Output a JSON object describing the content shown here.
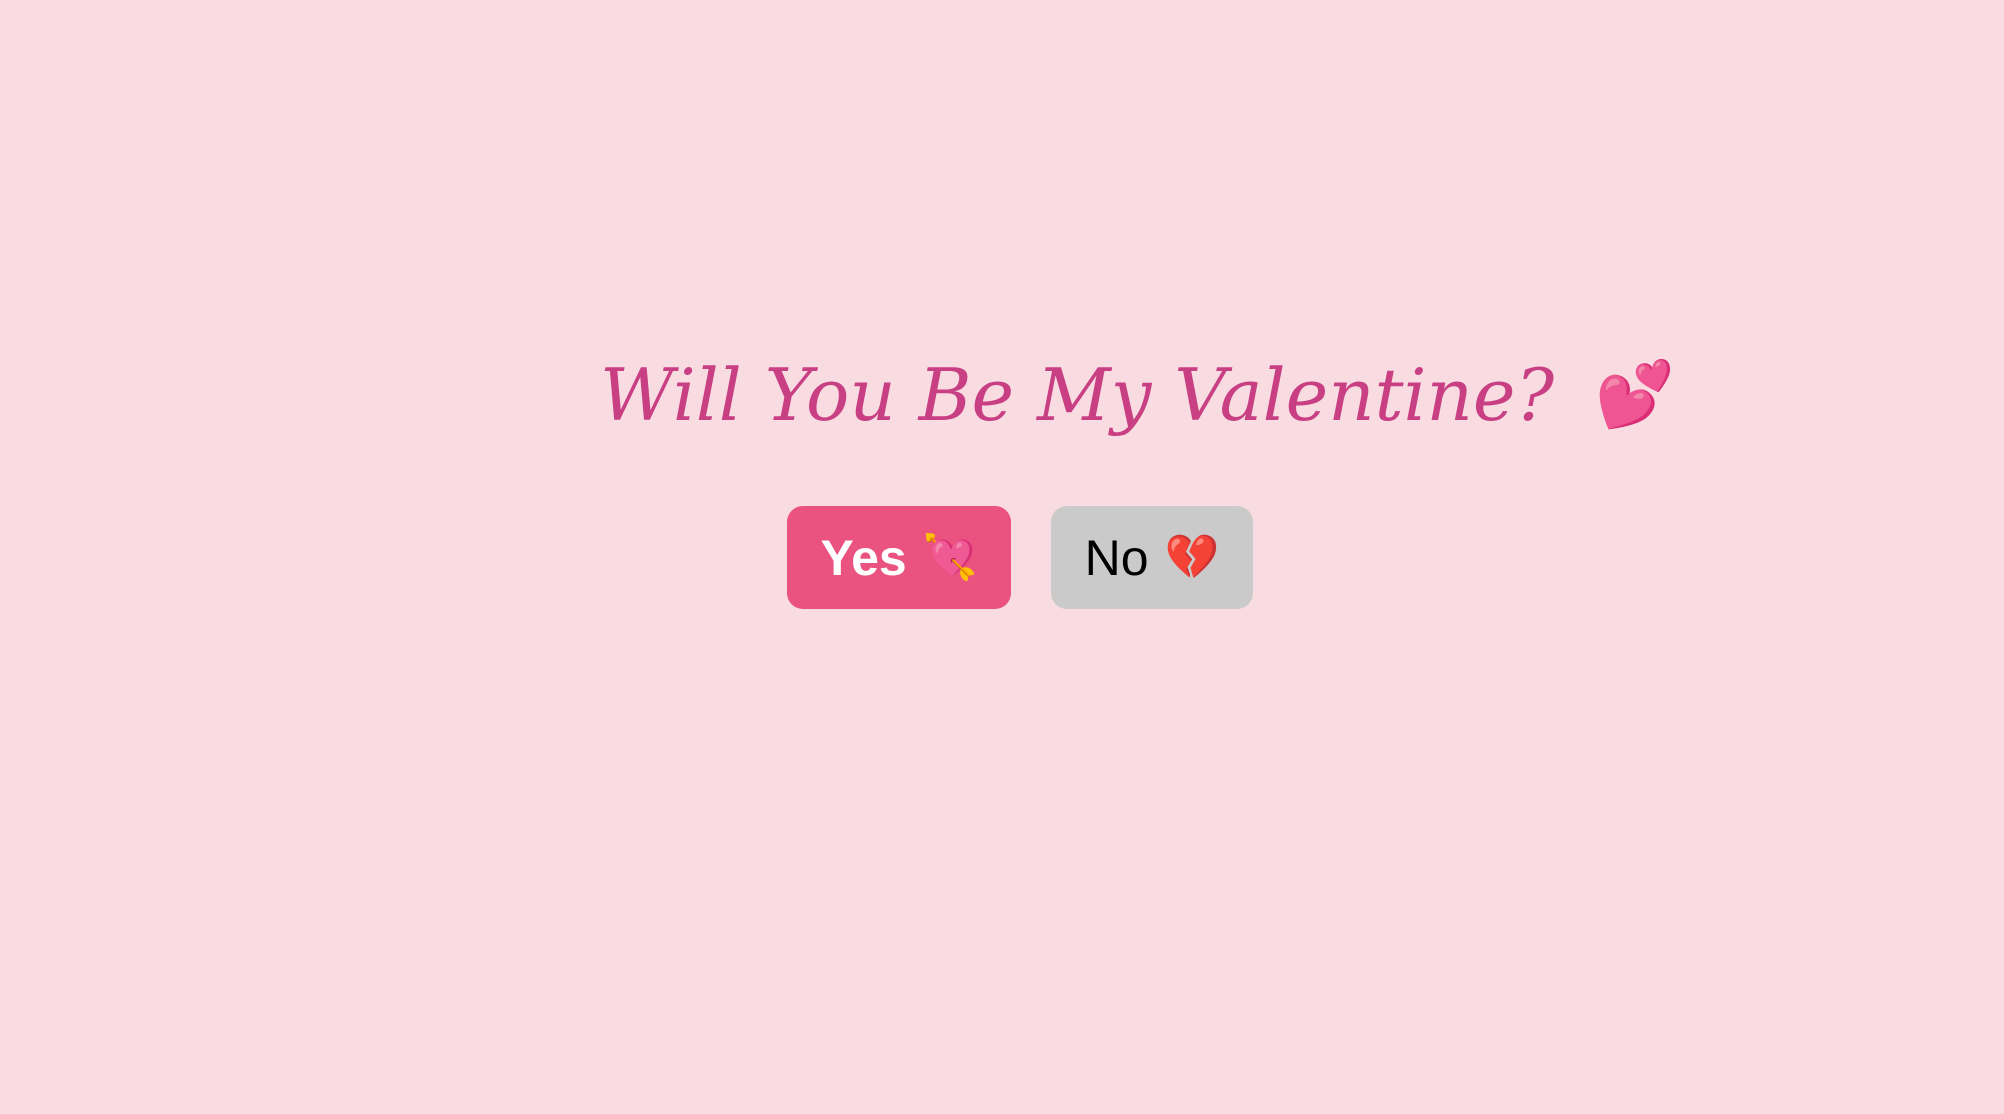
{
  "page": {
    "question": "Will You Be My Valentine?",
    "question_emoji": "💕"
  },
  "buttons": {
    "yes": {
      "label": "Yes",
      "emoji": "💘"
    },
    "no": {
      "label": "No",
      "emoji": "💔"
    }
  },
  "colors": {
    "background": "#f9dce1",
    "title": "#c93f84",
    "yes_button": "#ea527f",
    "no_button": "#cacaca"
  },
  "icons": {
    "question": "two-hearts-icon",
    "yes": "heart-with-arrow-icon",
    "no": "broken-heart-icon"
  }
}
